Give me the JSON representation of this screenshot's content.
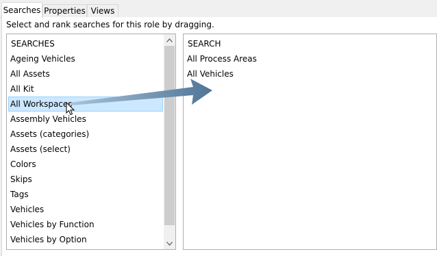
{
  "tabs": [
    "Searches",
    "Properties",
    "Views"
  ],
  "instructions": "Select and rank searches for this role by dragging.",
  "available": {
    "header": "SEARCHES",
    "items": [
      "Ageing Vehicles",
      "All Assets",
      "All Kit",
      "All Workspaces",
      "Assembly Vehicles",
      "Assets (categories)",
      "Assets (select)",
      "Colors",
      "Skips",
      "Tags",
      "Vehicles",
      "Vehicles by Function",
      "Vehicles by Option"
    ],
    "selected_item": "All Workspaces"
  },
  "assigned": {
    "header": "SEARCH",
    "items": [
      "All Process Areas",
      "All Vehicles"
    ]
  },
  "colors": {
    "selection_bg": "#cce8ff",
    "selection_border": "#99d1ff",
    "arrow": "#5f86a8"
  },
  "icons": [
    "chevron-up-icon",
    "chevron-down-icon",
    "mouse-cursor-icon",
    "drag-arrow-icon"
  ]
}
